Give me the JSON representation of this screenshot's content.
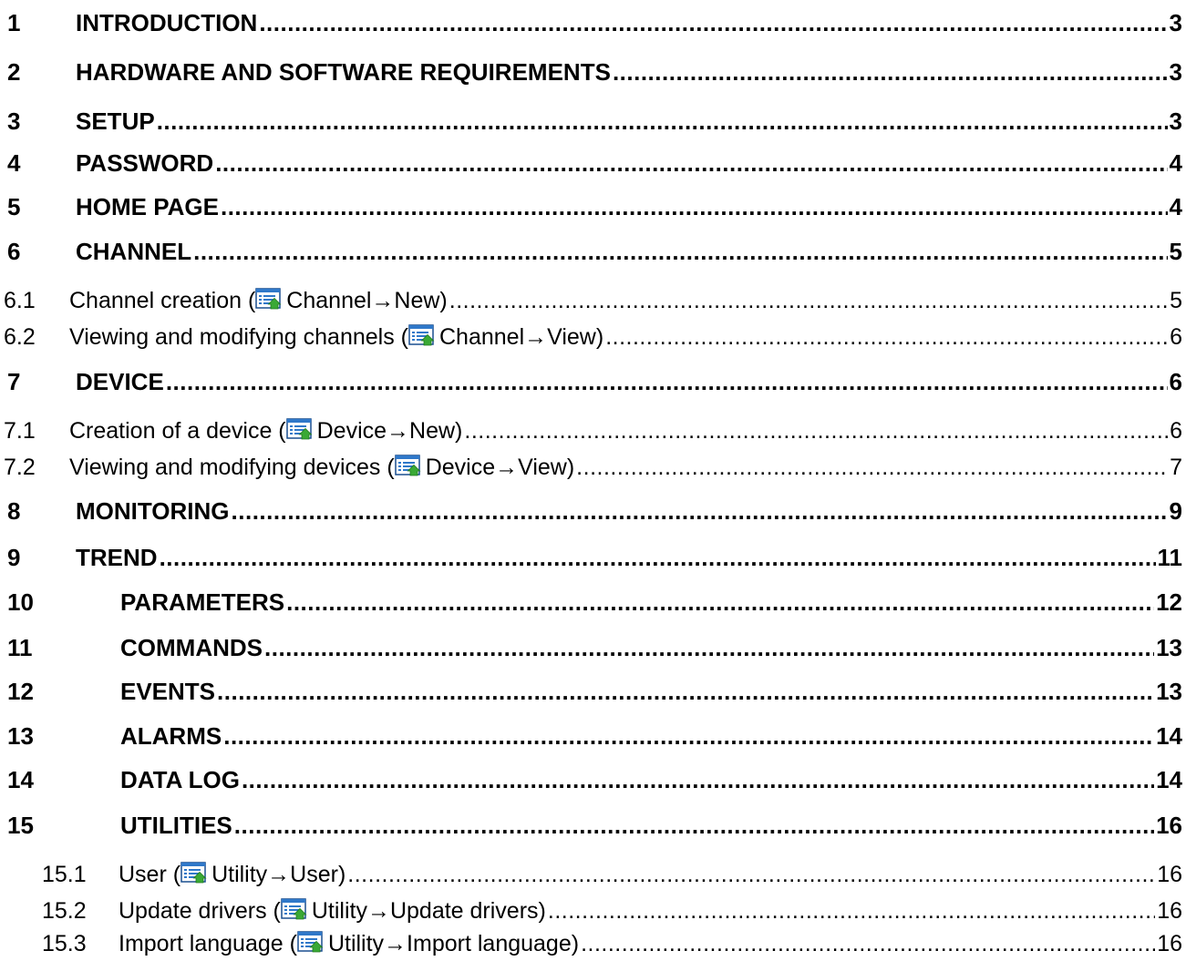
{
  "entries": [
    {
      "num": "1",
      "title": "INTRODUCTION",
      "page": "3"
    },
    {
      "num": "2",
      "title": "HARDWARE AND SOFTWARE REQUIREMENTS",
      "page": "3"
    },
    {
      "num": "3",
      "title": "SETUP",
      "page": "3"
    },
    {
      "num": "4",
      "title": "PASSWORD",
      "page": "4"
    },
    {
      "num": "5",
      "title": "HOME PAGE",
      "page": "4"
    },
    {
      "num": "6",
      "title": "CHANNEL",
      "page": "5"
    },
    {
      "num": "6.1",
      "title_pre": "Channel creation (",
      "title_post": "Channel→New)",
      "page": "5",
      "icon": "menu-list-icon"
    },
    {
      "num": "6.2",
      "title_pre": "Viewing and modifying channels (",
      "title_post": "Channel→View)",
      "page": "6",
      "icon": "menu-list-icon"
    },
    {
      "num": "7",
      "title": "DEVICE",
      "page": "6"
    },
    {
      "num": "7.1",
      "title_pre": "Creation of a device (",
      "title_post": "Device→New)",
      "page": "6",
      "icon": "menu-list-icon"
    },
    {
      "num": "7.2",
      "title_pre": "Viewing and modifying devices (",
      "title_post": "Device→View)",
      "page": "7",
      "icon": "menu-list-icon"
    },
    {
      "num": "8",
      "title": "MONITORING",
      "page": "9"
    },
    {
      "num": "9",
      "title": "TREND",
      "page": "11"
    },
    {
      "num": "10",
      "title": "PARAMETERS",
      "page": "12"
    },
    {
      "num": "11",
      "title": "COMMANDS",
      "page": "13"
    },
    {
      "num": "12",
      "title": "EVENTS",
      "page": "13"
    },
    {
      "num": "13",
      "title": "ALARMS",
      "page": "14"
    },
    {
      "num": "14",
      "title": "DATA LOG",
      "page": "14"
    },
    {
      "num": "15",
      "title": "UTILITIES",
      "page": "16"
    },
    {
      "num": "15.1",
      "title_pre": "User (",
      "title_post": "Utility→User)",
      "page": "16",
      "icon": "menu-list-icon"
    },
    {
      "num": "15.2",
      "title_pre": "Update drivers (",
      "title_post": "Utility→Update drivers)",
      "page": "16",
      "icon": "menu-list-icon"
    },
    {
      "num": "15.3",
      "title_pre": "Import language (",
      "title_post": "Utility→Import language)",
      "page": "16",
      "icon": "menu-list-icon"
    }
  ],
  "colors": {
    "text": "#000000",
    "icon_blue": "#2f78c9",
    "icon_frame": "#1a4f8f",
    "icon_arrow": "#3aa935"
  }
}
